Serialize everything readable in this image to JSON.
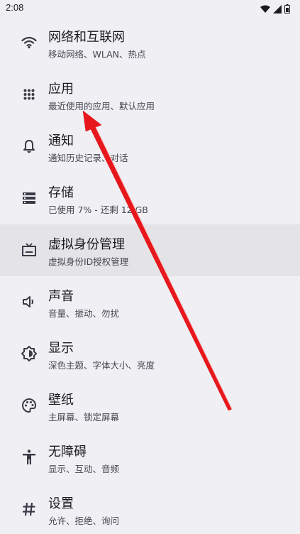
{
  "status_bar": {
    "time": "2:08",
    "icons": [
      "wifi-icon",
      "signal-icon",
      "battery-icon"
    ]
  },
  "settings": {
    "items": [
      {
        "icon": "wifi-icon",
        "title": "网络和互联网",
        "subtitle": "移动网络、WLAN、热点"
      },
      {
        "icon": "apps-grid-icon",
        "title": "应用",
        "subtitle": "最近使用的应用、默认应用"
      },
      {
        "icon": "bell-icon",
        "title": "通知",
        "subtitle": "通知历史记录、对话"
      },
      {
        "icon": "storage-icon",
        "title": "存储",
        "subtitle": "已使用 7% - 还剩 12 GB"
      },
      {
        "icon": "tv-icon",
        "title": "虚拟身份管理",
        "subtitle": "虚拟身份ID授权管理"
      },
      {
        "icon": "volume-icon",
        "title": "声音",
        "subtitle": "音量、振动、勿扰"
      },
      {
        "icon": "brightness-icon",
        "title": "显示",
        "subtitle": "深色主题、字体大小、亮度"
      },
      {
        "icon": "palette-icon",
        "title": "壁纸",
        "subtitle": "主屏幕、锁定屏幕"
      },
      {
        "icon": "accessibility-icon",
        "title": "无障碍",
        "subtitle": "显示、互动、音频"
      },
      {
        "icon": "hash-icon",
        "title": "设置",
        "subtitle": "允许、拒绝、询问"
      }
    ],
    "highlighted_item": "虚拟身份管理"
  },
  "annotation": {
    "icon": "red-arrow-icon",
    "color": "#e8171c",
    "points_to": "应用"
  }
}
